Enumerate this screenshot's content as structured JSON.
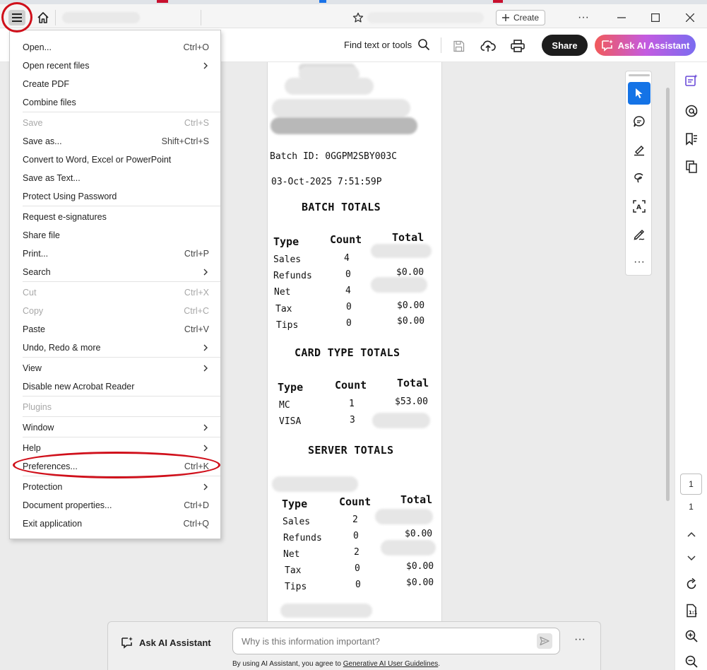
{
  "toolbar": {
    "create_label": "Create",
    "find_label": "Find text or tools",
    "share_label": "Share",
    "ai_label": "Ask AI Assistant"
  },
  "menu": {
    "items": [
      {
        "label": "Open...",
        "shortcut": "Ctrl+O"
      },
      {
        "label": "Open recent files",
        "shortcut": ""
      },
      {
        "label": "Create PDF",
        "shortcut": ""
      },
      {
        "label": "Combine files",
        "shortcut": ""
      },
      {
        "label": "Save",
        "shortcut": "Ctrl+S"
      },
      {
        "label": "Save as...",
        "shortcut": "Shift+Ctrl+S"
      },
      {
        "label": "Convert to Word, Excel or PowerPoint",
        "shortcut": ""
      },
      {
        "label": "Save as Text...",
        "shortcut": ""
      },
      {
        "label": "Protect Using Password",
        "shortcut": ""
      },
      {
        "label": "Request e-signatures",
        "shortcut": ""
      },
      {
        "label": "Share file",
        "shortcut": ""
      },
      {
        "label": "Print...",
        "shortcut": "Ctrl+P"
      },
      {
        "label": "Search",
        "shortcut": ""
      },
      {
        "label": "Cut",
        "shortcut": "Ctrl+X"
      },
      {
        "label": "Copy",
        "shortcut": "Ctrl+C"
      },
      {
        "label": "Paste",
        "shortcut": "Ctrl+V"
      },
      {
        "label": "Undo, Redo & more",
        "shortcut": ""
      },
      {
        "label": "View",
        "shortcut": ""
      },
      {
        "label": "Disable new Acrobat Reader",
        "shortcut": ""
      },
      {
        "label": "Plugins",
        "shortcut": ""
      },
      {
        "label": "Window",
        "shortcut": ""
      },
      {
        "label": "Help",
        "shortcut": ""
      },
      {
        "label": "Preferences...",
        "shortcut": "Ctrl+K"
      },
      {
        "label": "Protection",
        "shortcut": ""
      },
      {
        "label": "Document properties...",
        "shortcut": "Ctrl+D"
      },
      {
        "label": "Exit application",
        "shortcut": "Ctrl+Q"
      }
    ]
  },
  "receipt": {
    "batch_id": "Batch ID: 0GGPM2SBY003C",
    "datetime": "03-Oct-2025 7:51:59P",
    "batch_totals": {
      "heading": "BATCH TOTALS",
      "col_type": "Type",
      "col_count": "Count",
      "col_total": "Total",
      "rows": [
        {
          "type": "Sales",
          "count": "4",
          "total": ""
        },
        {
          "type": "Refunds",
          "count": "0",
          "total": "$0.00"
        },
        {
          "type": "Net",
          "count": "4",
          "total": ""
        },
        {
          "type": "Tax",
          "count": "0",
          "total": "$0.00"
        },
        {
          "type": "Tips",
          "count": "0",
          "total": "$0.00"
        }
      ]
    },
    "card_totals": {
      "heading": "CARD TYPE TOTALS",
      "col_type": "Type",
      "col_count": "Count",
      "col_total": "Total",
      "rows": [
        {
          "type": "MC",
          "count": "1",
          "total": "$53.00"
        },
        {
          "type": "VISA",
          "count": "3",
          "total": ""
        }
      ]
    },
    "server_totals": {
      "heading": "SERVER TOTALS",
      "col_type": "Type",
      "col_count": "Count",
      "col_total": "Total",
      "rows": [
        {
          "type": "Sales",
          "count": "2",
          "total": ""
        },
        {
          "type": "Refunds",
          "count": "0",
          "total": "$0.00"
        },
        {
          "type": "Net",
          "count": "2",
          "total": ""
        },
        {
          "type": "Tax",
          "count": "0",
          "total": "$0.00"
        },
        {
          "type": "Tips",
          "count": "0",
          "total": "$0.00"
        }
      ]
    }
  },
  "page_nav": {
    "current": "1",
    "total": "1"
  },
  "ai_bar": {
    "label": "Ask AI Assistant",
    "placeholder": "Why is this information important?",
    "footer_prefix": "By using AI Assistant, you agree to ",
    "footer_link": "Generative AI User Guidelines",
    "footer_suffix": "."
  },
  "colors": {
    "accent": "#1473e6",
    "annotation_red": "#d0101b",
    "share_bg": "#1d1d1d"
  }
}
